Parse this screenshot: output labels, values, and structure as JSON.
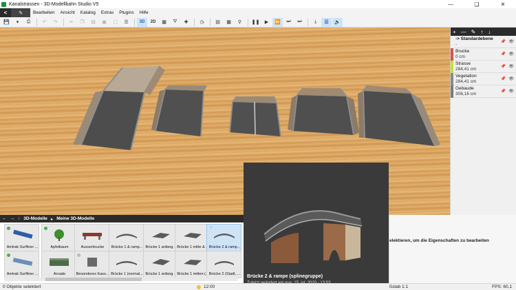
{
  "window": {
    "title": "Kanalstrassen - 3D-Modellbahn Studio V5"
  },
  "menu": {
    "back": "<",
    "edit_icon": "pencil-icon",
    "items": [
      "Bearbeiten",
      "Ansicht",
      "Katalog",
      "Extras",
      "Plugins",
      "Hilfe"
    ]
  },
  "toolbar": {
    "view_3d": "3D",
    "view_2d": "2D"
  },
  "layers": [
    {
      "name": "-> Standardebene",
      "value": "-",
      "color": "#ffffff"
    },
    {
      "name": "Brucke",
      "value": "0 cm",
      "color": "#d9534f"
    },
    {
      "name": "Strasse",
      "value": "284,41 cm",
      "color": "#c6e03a"
    },
    {
      "name": "Vegetation",
      "value": "284,41 cm",
      "color": "#8a8a8a"
    },
    {
      "name": "Gebaude",
      "value": "306,16 cm",
      "color": "#7a7a7a"
    }
  ],
  "catalog": {
    "path": [
      "3D-Modelle",
      "Meine 3D-Modelle"
    ],
    "tiles": [
      {
        "label": "Amtrak Surfliner ...",
        "dot": "green"
      },
      {
        "label": "Apfelbaum",
        "dot": "green"
      },
      {
        "label": "Ausserbrucke",
        "dot": ""
      },
      {
        "label": "Brücke 1 & ramp...",
        "dot": ""
      },
      {
        "label": "Brücke 1 anfang ...",
        "dot": ""
      },
      {
        "label": "Brücke 1 mitte & ...",
        "dot": ""
      },
      {
        "label": "Brücke 2 & ramp...",
        "dot": "gray",
        "selected": true
      },
      {
        "label": "Amtrak Surfliner ...",
        "dot": "green"
      },
      {
        "label": "Arcade",
        "dot": ""
      },
      {
        "label": "Besonderes Kass...",
        "dot": "gray"
      },
      {
        "label": "Brücke 1 (normal...",
        "dot": ""
      },
      {
        "label": "Brücke 1 anfang ...",
        "dot": ""
      },
      {
        "label": "Brücke 1 mitten (...",
        "dot": ""
      },
      {
        "label": "Brücke 2 (Stadt, ...",
        "dot": ""
      }
    ]
  },
  "properties": {
    "hint": "elektieren, um die Eigenschaften zu bearbeiten"
  },
  "preview": {
    "title": "Brücke 2 & rampe (splinegruppe)",
    "subtitle": "Zuletzt geändert am qua, 15. jul. 2020 - 13:53"
  },
  "status": {
    "selection": "0 Objekte selektiert",
    "time": "12:00",
    "scale": "ßstab 1:1",
    "fps": "FPS: 60,1"
  }
}
